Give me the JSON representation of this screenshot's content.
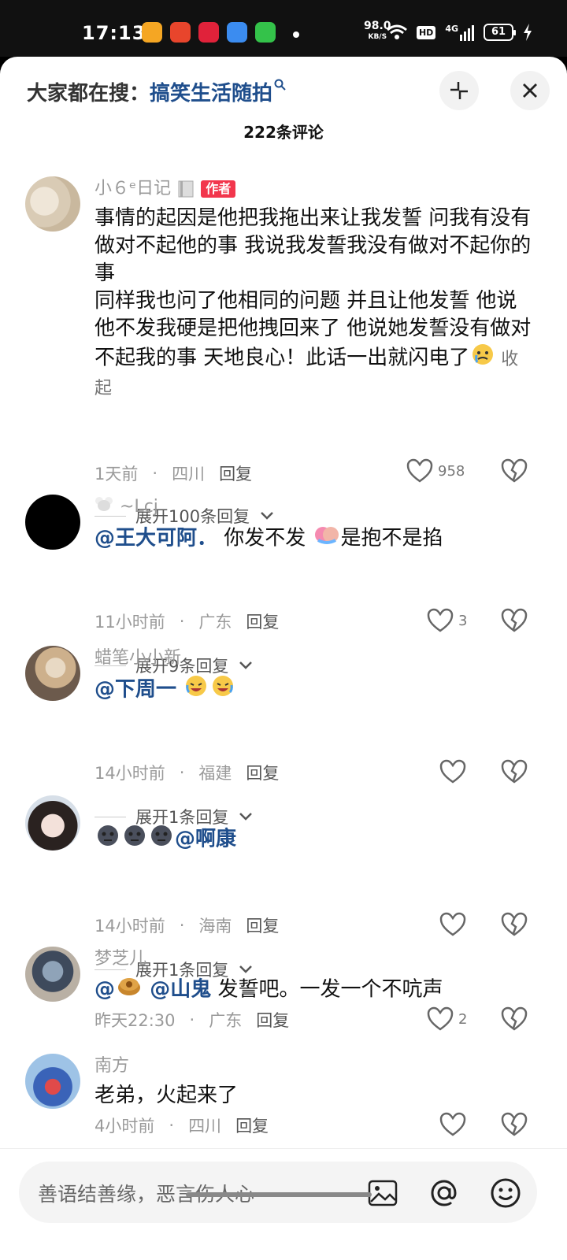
{
  "status": {
    "time": "17:13",
    "speed": "98.0",
    "speed_unit": "KB/S",
    "hd": "HD",
    "net": "4G",
    "battery": "61"
  },
  "header": {
    "search_prefix": "大家都在搜：",
    "search_term": "搞笑生活随拍",
    "comment_count": "222条评论"
  },
  "comments": [
    {
      "user": "小６ᵉ日记",
      "badge": "作者",
      "text": "事情的起因是他把我拖出来让我发誓 问我有没有做对不起他的事 我说我发誓我没有做对不起你的事\n同样我也问了他相同的问题 并且让他发誓 他说他不发我硬是把他拽回来了 他说她发誓没有做对不起我的事 天地良心！此话一出就闪电了",
      "collapse": "收起",
      "time": "1天前",
      "location": "四川",
      "reply": "回复",
      "likes": "958",
      "expand": "展开100条回复"
    },
    {
      "user": "~Lcj",
      "mention": "@王大可阿．",
      "text_a": " 你发不发 ",
      "text_b": "是抱不是掐",
      "time": "11小时前",
      "location": "广东",
      "reply": "回复",
      "likes": "3",
      "expand": "展开9条回复"
    },
    {
      "user": "蜡笔小小新",
      "mention": "@下周一",
      "time": "14小时前",
      "location": "福建",
      "reply": "回复",
      "likes": "",
      "expand": "展开1条回复"
    },
    {
      "user": "",
      "mention": "@啊康",
      "time": "14小时前",
      "location": "海南",
      "reply": "回复",
      "likes": "",
      "expand": "展开1条回复"
    },
    {
      "user": "梦芝儿",
      "mention_a": "@",
      "mention_b": "@山鬼",
      "text": " 发誓吧。一发一个不吭声",
      "time": "昨天22:30",
      "location": "广东",
      "reply": "回复",
      "likes": "2"
    },
    {
      "user": "南方",
      "text": "老弟，火起来了",
      "time": "4小时前",
      "location": "四川",
      "reply": "回复",
      "likes": ""
    }
  ],
  "input": {
    "placeholder": "善语结善缘，恶言伤人心"
  },
  "colors": {
    "accent_blue": "#1f4e8c",
    "author_badge": "#f2364d"
  }
}
